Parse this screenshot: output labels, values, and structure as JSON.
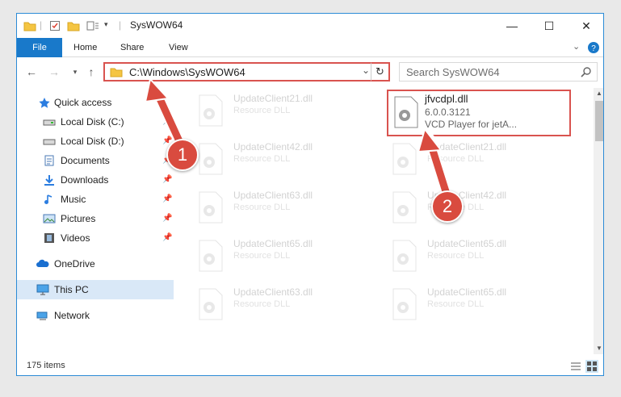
{
  "window": {
    "title": "SysWOW64",
    "controls": {
      "minimize": "—",
      "maximize": "☐",
      "close": "✕"
    }
  },
  "ribbon": {
    "tabs": [
      {
        "label": "File"
      },
      {
        "label": "Home"
      },
      {
        "label": "Share"
      },
      {
        "label": "View"
      }
    ]
  },
  "navigation": {
    "address": "C:\\Windows\\SysWOW64",
    "search_placeholder": "Search SysWOW64"
  },
  "sidebar": {
    "items": [
      {
        "label": "Quick access",
        "icon": "star-icon"
      },
      {
        "label": "Local Disk (C:)",
        "icon": "drive-icon"
      },
      {
        "label": "Local Disk (D:)",
        "icon": "drive-icon"
      },
      {
        "label": "Documents",
        "icon": "documents-icon"
      },
      {
        "label": "Downloads",
        "icon": "download-icon"
      },
      {
        "label": "Music",
        "icon": "music-icon"
      },
      {
        "label": "Pictures",
        "icon": "pictures-icon"
      },
      {
        "label": "Videos",
        "icon": "videos-icon"
      },
      {
        "label": "OneDrive",
        "icon": "cloud-icon"
      },
      {
        "label": "This PC",
        "icon": "computer-icon"
      },
      {
        "label": "Network",
        "icon": "network-icon"
      }
    ]
  },
  "files": {
    "highlight": {
      "name": "jfvcdpl.dll",
      "version": "6.0.0.3121",
      "description": "VCD Player for jetA..."
    },
    "tiles": [
      {
        "name": "UpdateClient21.dll",
        "type": "Resource DLL"
      },
      {
        "name": "UpdateClient42.dll",
        "type": "Resource DLL"
      },
      {
        "name": "UpdateClient21.dll",
        "type": "Resource DLL"
      },
      {
        "name": "UpdateClient63.dll",
        "type": "Resource DLL"
      },
      {
        "name": "UpdateClient42.dll",
        "type": "Resource DLL"
      },
      {
        "name": "UpdateClient65.dll",
        "type": "Resource DLL"
      },
      {
        "name": "UpdateClient65.dll",
        "type": "Resource DLL"
      },
      {
        "name": "UpdateClient63.dll",
        "type": "Resource DLL"
      },
      {
        "name": "UpdateClient65.dll",
        "type": "Resource DLL"
      }
    ]
  },
  "status": {
    "item_count": "175 items"
  },
  "annotations": {
    "step1": "1",
    "step2": "2",
    "color": "#d94b3f"
  }
}
